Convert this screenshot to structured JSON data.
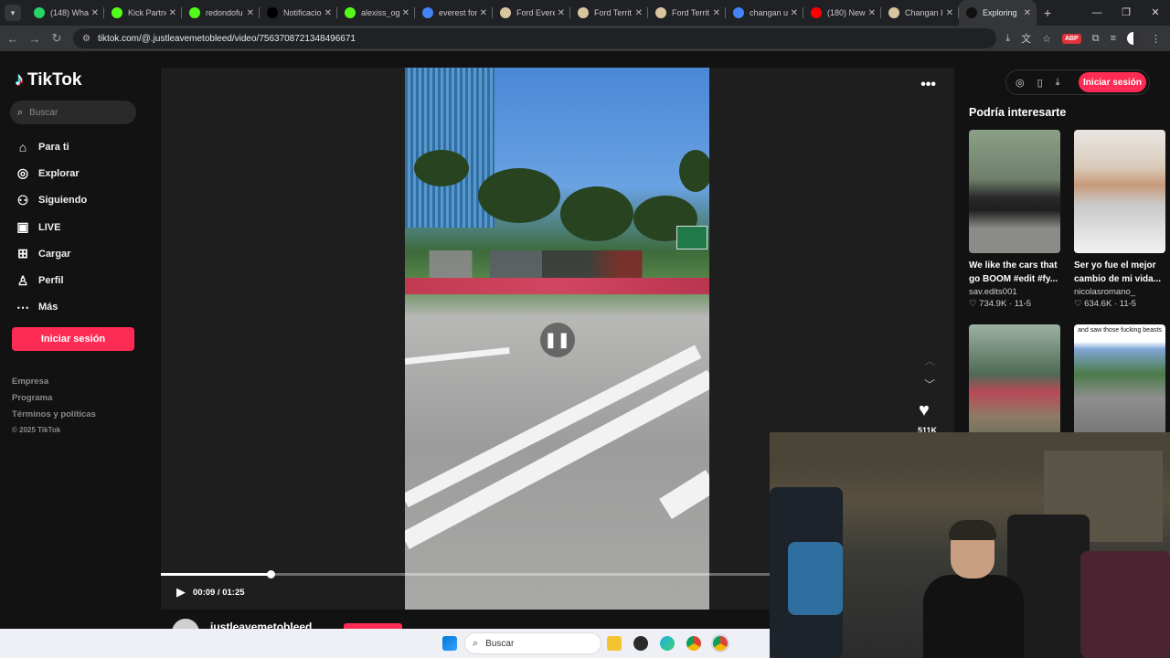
{
  "browser": {
    "tabs": [
      {
        "title": "(148) Wha",
        "fav_color": "#25d366"
      },
      {
        "title": "Kick Partne",
        "fav_color": "#53fc18"
      },
      {
        "title": "redondofu",
        "fav_color": "#53fc18"
      },
      {
        "title": "Notificacio",
        "fav_color": "#000000"
      },
      {
        "title": "alexiss_og",
        "fav_color": "#53fc18"
      },
      {
        "title": "everest for",
        "fav_color": "#4285f4"
      },
      {
        "title": "Ford Evere",
        "fav_color": "#d9c6a0"
      },
      {
        "title": "Ford Territ",
        "fav_color": "#d9c6a0"
      },
      {
        "title": "Ford Territ",
        "fav_color": "#d9c6a0"
      },
      {
        "title": "changan u",
        "fav_color": "#4285f4"
      },
      {
        "title": "(180) New",
        "fav_color": "#ff0000"
      },
      {
        "title": "Changan I",
        "fav_color": "#d9c6a0"
      },
      {
        "title": "Exploring",
        "fav_color": "#111111"
      }
    ],
    "close_glyph": "✕",
    "new_tab_glyph": "+",
    "window_controls": [
      "—",
      "❐",
      "✕"
    ],
    "url": "tiktok.com/@.justleavemetobleed/video/7563708721348496671",
    "abp_label": "ABP"
  },
  "sidebar": {
    "logo": "TikTok",
    "search_placeholder": "Buscar",
    "nav": [
      {
        "label": "Para ti",
        "icon": "home-icon"
      },
      {
        "label": "Explorar",
        "icon": "compass-icon"
      },
      {
        "label": "Siguiendo",
        "icon": "user-follow-icon"
      },
      {
        "label": "LIVE",
        "icon": "live-icon"
      },
      {
        "label": "Cargar",
        "icon": "upload-icon"
      },
      {
        "label": "Perfil",
        "icon": "profile-icon"
      },
      {
        "label": "Más",
        "icon": "more-icon"
      }
    ],
    "login_button": "Iniciar sesión",
    "footer": [
      "Empresa",
      "Programa",
      "Términos y políticas"
    ],
    "copyright": "© 2025 TikTok"
  },
  "player": {
    "time": "00:09 / 01:25",
    "progress": 0.138,
    "likes": "511K",
    "author": "justleavemetobleed"
  },
  "right": {
    "login_button": "Iniciar sesión",
    "section_title": "Podría interesarte",
    "suggestions": [
      {
        "title": "We like the cars that go BOOM #edit #fy...",
        "user": "sav.edits001",
        "likes": "734.9K",
        "date": "11-5",
        "caption": ""
      },
      {
        "title": "Ser yo fue el mejor cambio de mi vida...",
        "user": "nicolasromano_",
        "likes": "634.6K",
        "date": "11-5",
        "caption": ""
      },
      {
        "title": "",
        "user": "",
        "likes": "",
        "date": "",
        "caption": ""
      },
      {
        "title": "",
        "user": "",
        "likes": "",
        "date": "",
        "caption": "and saw those fucking beasts"
      }
    ]
  },
  "taskbar": {
    "search_placeholder": "Buscar"
  },
  "colors": {
    "accent": "#fe2c55",
    "page_bg": "#121212"
  }
}
